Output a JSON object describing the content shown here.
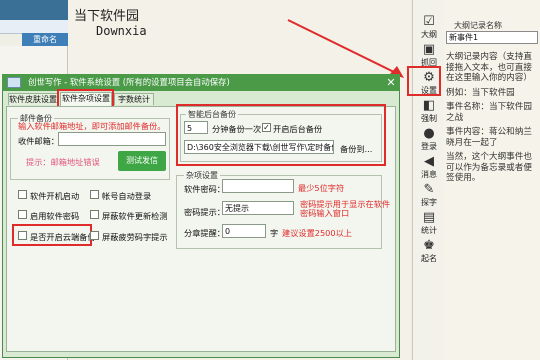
{
  "background": {
    "rename_button": "重命名",
    "editor_title": "当下软件园",
    "editor_sub": "Downxia"
  },
  "toolbar": {
    "items": [
      {
        "label": "大纲",
        "icon": "outline-icon"
      },
      {
        "label": "抓回",
        "icon": "recover-icon"
      },
      {
        "label": "设置",
        "icon": "gear-icon"
      },
      {
        "label": "强制",
        "icon": "force-icon"
      },
      {
        "label": "登录",
        "icon": "user-icon"
      },
      {
        "label": "消息",
        "icon": "speaker-icon"
      },
      {
        "label": "探字",
        "icon": "search-char-icon"
      },
      {
        "label": "统计",
        "icon": "chart-icon"
      },
      {
        "label": "起名",
        "icon": "name-icon"
      }
    ]
  },
  "notes": {
    "label": "大纲记录名称",
    "select_value": "新事件1",
    "lines": [
      "大纲记录内容（支持直接拖入文本，也可直接在这里输入你的内容）",
      "例如：当下软件园",
      "事件名称：当下软件园之战",
      "事件内容：蒋公和纳兰晓月在一起了",
      "当然，这个大纲事件也可以作为备忘录或者便签使用。"
    ]
  },
  "dialog": {
    "title": "创世写作 - 软件系统设置 (所有的设置项目会自动保存)",
    "tabs": [
      "软件皮肤设置",
      "软件杂项设置",
      "字数统计设置"
    ],
    "active_tab": 1,
    "mail_group": {
      "title": "邮件备份",
      "hint": "输入软件邮箱地址，即可添加邮件备份。",
      "email_label": "收件邮箱：",
      "email_value": "",
      "tip": "提示：邮箱地址错误",
      "test_button": "测试发信"
    },
    "backup_group": {
      "title": "智能后台备份",
      "minutes": "5",
      "minutes_label": "分钟备份一次",
      "enable_label": "开启后台备份",
      "enable_checked": true,
      "path": "D:\\360安全浏览器下载\\创世写作\\定时备份\\我",
      "path_button": "备份到..."
    },
    "checkboxes_left": [
      "软件开机启动",
      "启用软件密码",
      "是否开启云端备份"
    ],
    "checkboxes_right": [
      "帐号自动登录",
      "屏蔽软件更新检测",
      "屏蔽疲劳码字提示"
    ],
    "misc_group": {
      "title": "杂项设置",
      "password_label": "软件密码：",
      "password_value": "",
      "password_note": "最少5位字符",
      "hint_label": "密码提示：",
      "hint_value": "无提示",
      "hint_note_1": "密码提示用于显示在软件",
      "hint_note_2": "密码输入窗口",
      "split_label": "分章提醒：",
      "split_value": "0",
      "split_unit": "字",
      "split_note": "建议设置2500以上"
    }
  },
  "colors": {
    "dialog_title": "#4a9a48",
    "annotation": "#e02b2b",
    "test_button": "#3fa646",
    "tip_text": "#e0557b"
  }
}
